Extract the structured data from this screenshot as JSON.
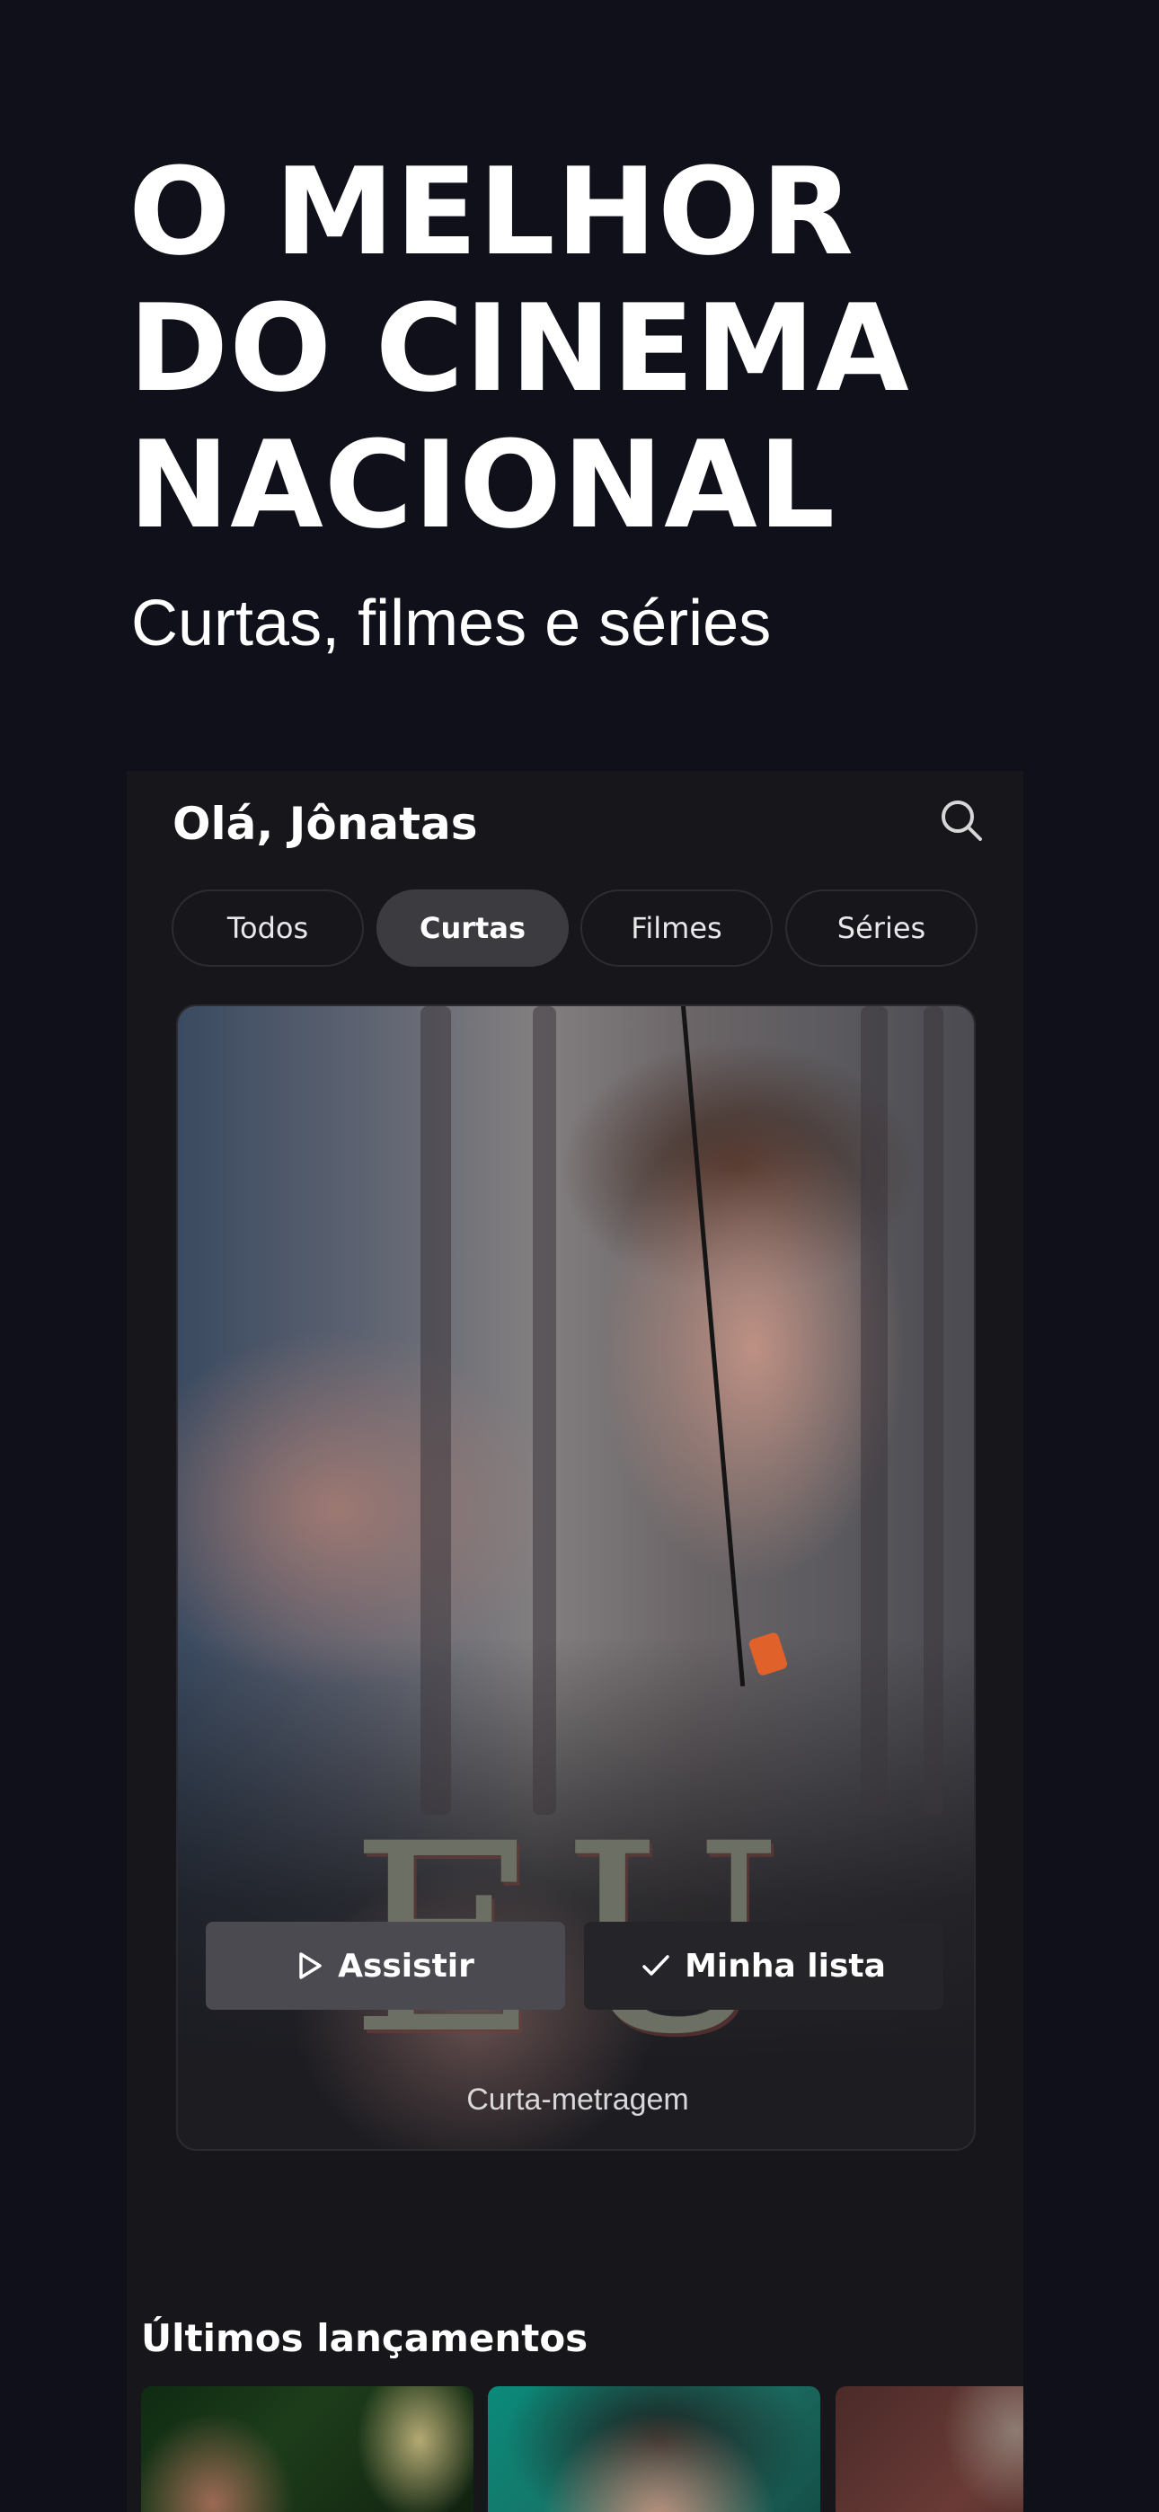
{
  "promo": {
    "headline": [
      "O MELHOR",
      "DO CINEMA",
      "NACIONAL"
    ],
    "subheadline": "Curtas, filmes e séries"
  },
  "app": {
    "greeting": "Olá, Jônatas",
    "search_icon": "search-icon",
    "filters": [
      {
        "label": "Todos",
        "selected": false
      },
      {
        "label": "Curtas",
        "selected": true
      },
      {
        "label": "Filmes",
        "selected": false
      },
      {
        "label": "Séries",
        "selected": false
      }
    ],
    "featured": {
      "title": "EU",
      "category": "Curta-metragem",
      "play_label": "Assistir",
      "play_icon": "play-icon",
      "list_label": "Minha lista",
      "list_icon": "check-icon"
    },
    "latest": {
      "title": "Últimos lançamentos"
    }
  },
  "colors": {
    "background": "#10101a",
    "surface": "#17171b",
    "chip_active": "#3b3b40",
    "play_button": "#4a4a50",
    "list_button": "#252529"
  }
}
